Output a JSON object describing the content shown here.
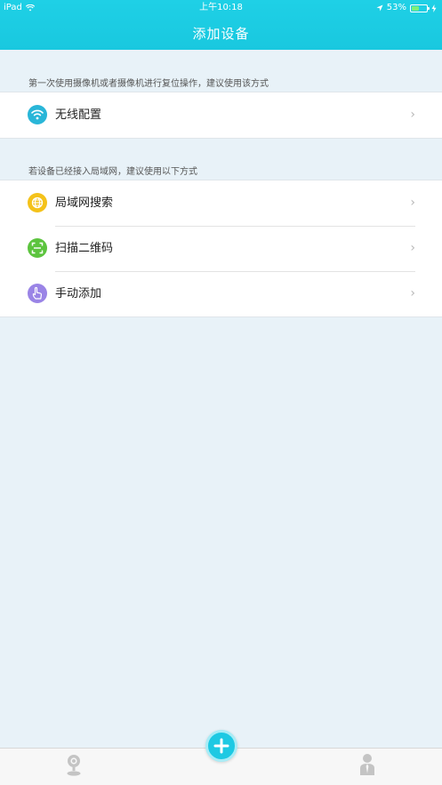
{
  "status_bar": {
    "device": "iPad",
    "time": "上午10:18",
    "battery": "53%",
    "battery_level": 0.53
  },
  "nav": {
    "title": "添加设备"
  },
  "section1": {
    "hint": "第一次使用摄像机或者摄像机进行复位操作，建议使用该方式",
    "items": [
      {
        "label": "无线配置",
        "icon": "wifi-icon",
        "color": "#29b6d8"
      }
    ]
  },
  "section2": {
    "hint": "若设备已经接入局域网，建议使用以下方式",
    "items": [
      {
        "label": "局域网搜索",
        "icon": "globe-icon",
        "color": "#f4c21a"
      },
      {
        "label": "扫描二维码",
        "icon": "qr-scan-icon",
        "color": "#5cc43e"
      },
      {
        "label": "手动添加",
        "icon": "hand-icon",
        "color": "#9a84e6"
      }
    ]
  },
  "chevron": "›",
  "tabbar": {
    "tabs": [
      {
        "icon": "camera-icon"
      },
      {
        "icon": "add-icon"
      },
      {
        "icon": "user-icon"
      }
    ]
  }
}
